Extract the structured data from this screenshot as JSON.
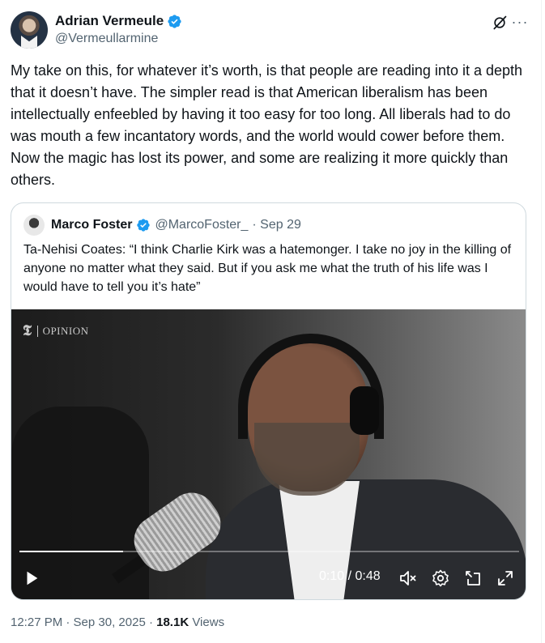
{
  "tweet": {
    "author": {
      "display_name": "Adrian Vermeule",
      "handle": "@Vermeullarmine",
      "verified": true
    },
    "text": "My take on this, for whatever it’s worth, is that people are reading into it a depth that it doesn’t have. The simpler read is that American liberalism has been intellectually enfeebled by having it too easy for too long. All liberals had to do was mouth a few incantatory words, and the world would cower before them. Now the magic has lost its power, and some are realizing it more quickly than others.",
    "timestamp": "12:27 PM · Sep 30, 2025",
    "separator": " · ",
    "views_count": "18.1K",
    "views_label": " Views"
  },
  "quote": {
    "display_name": "Marco Foster",
    "handle": "@MarcoFoster_",
    "date": "· Sep 29",
    "text": "Ta-Nehisi Coates: “I think Charlie Kirk was a hatemonger. I take no joy in the killing of anyone no matter what they said. But if you ask me what the truth of his life was I would have to tell you it’s hate”"
  },
  "video": {
    "watermark_logo": "𝕿",
    "watermark_text": "OPINION",
    "time": "0:10 / 0:48",
    "progress": 0.208
  },
  "icons": {
    "verified": "verified-badge-icon",
    "grok": "grok-icon",
    "more": "more-icon",
    "play": "play-icon",
    "mute": "volume-muted-icon",
    "settings": "settings-gear-icon",
    "pip": "picture-in-picture-icon",
    "fullscreen": "fullscreen-icon"
  },
  "colors": {
    "accent": "#1d9bf0",
    "text_primary": "#0f1419",
    "text_secondary": "#536471",
    "border": "#cfd9de"
  }
}
